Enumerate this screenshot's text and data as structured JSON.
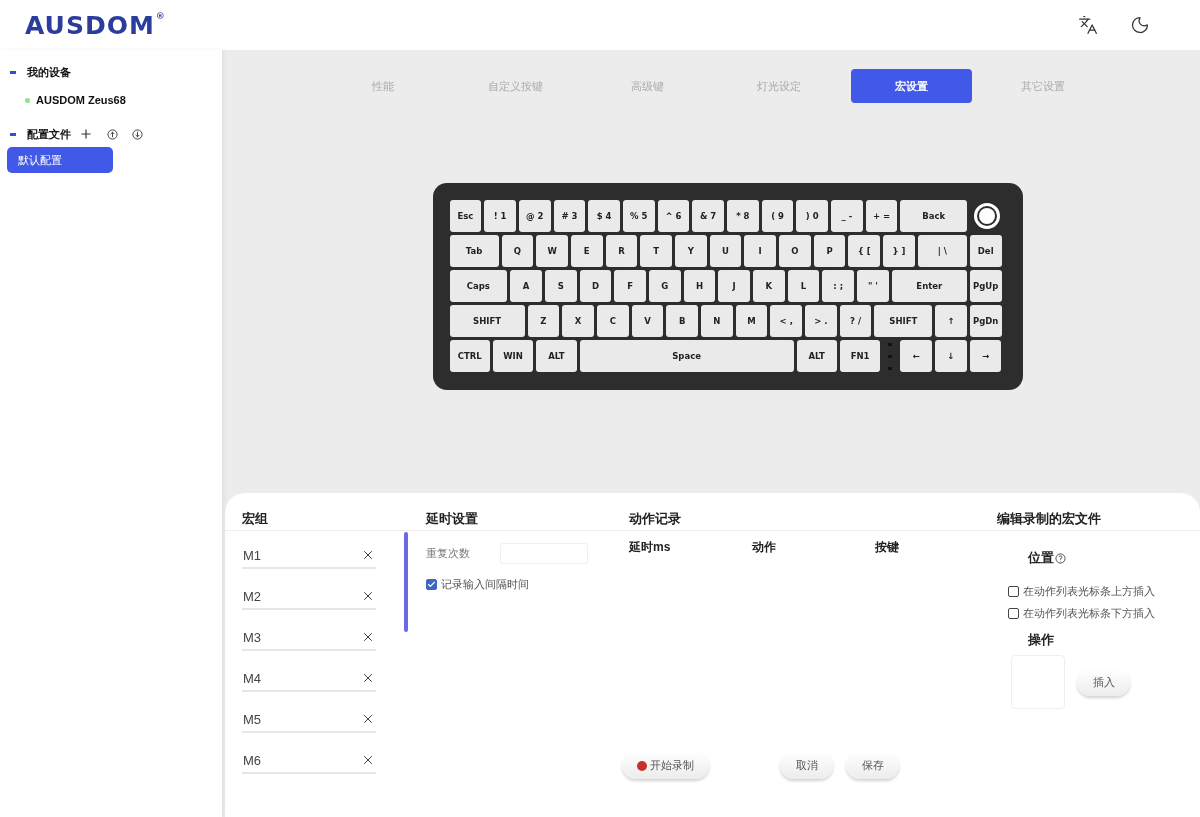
{
  "header": {
    "logo": "AUSDOM",
    "logo_mark": "®"
  },
  "sidebar": {
    "device_section": "我的设备",
    "devices": [
      {
        "name": "AUSDOM Zeus68",
        "connected": true
      }
    ],
    "profile_section": "配置文件",
    "profiles": [
      {
        "name": "默认配置",
        "selected": true
      }
    ]
  },
  "tabs": [
    {
      "label": "性能",
      "selected": false
    },
    {
      "label": "自定义按键",
      "selected": false
    },
    {
      "label": "高级键",
      "selected": false
    },
    {
      "label": "灯光设定",
      "selected": false
    },
    {
      "label": "宏设置",
      "selected": true
    },
    {
      "label": "其它设置",
      "selected": false
    }
  ],
  "keyboard": {
    "key_rows": [
      {
        "keys": [
          "Esc",
          "! 1",
          "@ 2",
          "# 3",
          "$ 4",
          "% 5",
          "^ 6",
          "& 7",
          "* 8",
          "( 9",
          ") 0",
          "_ -",
          "+ =",
          "Back"
        ]
      },
      {
        "keys": [
          "Tab",
          "Q",
          "W",
          "E",
          "R",
          "T",
          "Y",
          "U",
          "I",
          "O",
          "P",
          "{ [",
          "} ]",
          "| \\",
          "Del"
        ]
      },
      {
        "keys": [
          "Caps",
          "A",
          "S",
          "D",
          "F",
          "G",
          "H",
          "J",
          "K",
          "L",
          ": ;",
          "\" '",
          "Enter",
          "PgUp"
        ]
      },
      {
        "keys": [
          "SHIFT",
          "Z",
          "X",
          "C",
          "V",
          "B",
          "N",
          "M",
          "< ,",
          "> .",
          "? /",
          "SHIFT",
          "↑",
          "PgDn"
        ]
      },
      {
        "keys": [
          "CTRL",
          "WIN",
          "ALT",
          "Space",
          "ALT",
          "FN1",
          "←",
          "↓",
          "→"
        ]
      }
    ]
  },
  "macro_panel": {
    "groups_title": "宏组",
    "macros": [
      {
        "name": "M1"
      },
      {
        "name": "M2"
      },
      {
        "name": "M3"
      },
      {
        "name": "M4"
      },
      {
        "name": "M5"
      },
      {
        "name": "M6"
      }
    ],
    "delay_title": "延时设置",
    "repeat_label": "重复次数",
    "record_interval": {
      "label": "记录输入间隔时间",
      "checked": true
    },
    "actions_title": "动作记录",
    "action_columns": [
      "延时ms",
      "动作",
      "按键"
    ],
    "record_button": "开始录制",
    "cancel_button": "取消",
    "save_button": "保存",
    "edit_title": "编辑录制的宏文件",
    "position_label": "位置",
    "position_options": [
      {
        "label": "在动作列表光标条上方插入",
        "checked": false
      },
      {
        "label": "在动作列表光标条下方插入",
        "checked": false
      }
    ],
    "operation_label": "操作",
    "insert_button": "插入"
  }
}
